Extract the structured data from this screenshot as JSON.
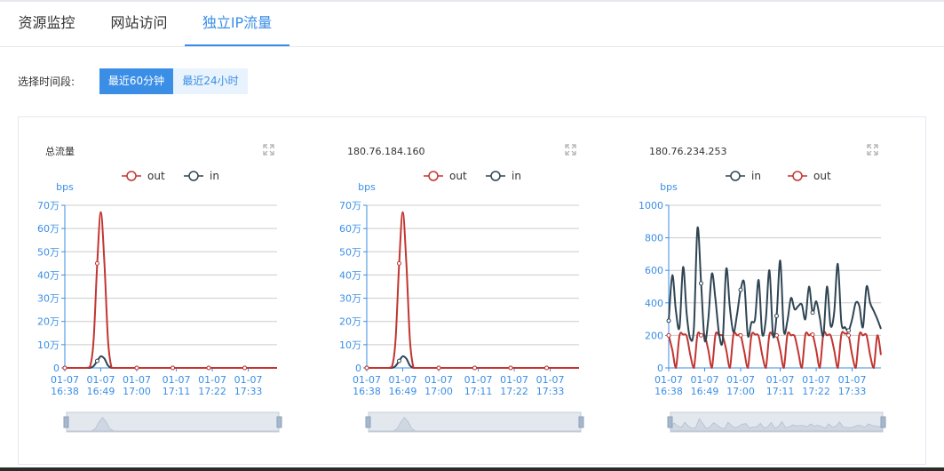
{
  "tabs": [
    {
      "label": "资源监控"
    },
    {
      "label": "网站访问"
    },
    {
      "label": "独立IP流量"
    }
  ],
  "time_range": {
    "label": "选择时间段:",
    "options": [
      "最近60分钟",
      "最近24小时"
    ],
    "selected": "最近60分钟"
  },
  "colors": {
    "out": "#c23531",
    "in": "#2f4554",
    "axis": "#3a8ee6",
    "accent": "#3a8ee6"
  },
  "chart_data": [
    {
      "type": "line",
      "title": "总流量",
      "ylabel": "bps",
      "legend": [
        "out",
        "in"
      ],
      "ylim": [
        0,
        700000
      ],
      "yticks": [
        0,
        100000,
        200000,
        300000,
        400000,
        500000,
        600000,
        700000
      ],
      "ytick_labels": [
        "0",
        "10万",
        "20万",
        "30万",
        "40万",
        "50万",
        "60万",
        "70万"
      ],
      "xtick_labels": [
        [
          "01-07",
          "16:38"
        ],
        [
          "01-07",
          "16:49"
        ],
        [
          "01-07",
          "17:00"
        ],
        [
          "01-07",
          "17:11"
        ],
        [
          "01-07",
          "17:22"
        ],
        [
          "01-07",
          "17:33"
        ]
      ],
      "x_count": 60,
      "series": [
        {
          "name": "out",
          "values": [
            0,
            0,
            0,
            0,
            0,
            0,
            0,
            5000,
            120000,
            450000,
            670000,
            450000,
            120000,
            0,
            0,
            0,
            0,
            0,
            0,
            0,
            0,
            0,
            0,
            0,
            0,
            0,
            0,
            0,
            0,
            0,
            0,
            0,
            0,
            0,
            0,
            0,
            0,
            0,
            0,
            0,
            0,
            0,
            0,
            0,
            0,
            0,
            0,
            0,
            0,
            0,
            0,
            0,
            0,
            0,
            0,
            0,
            0,
            0,
            0,
            0
          ]
        },
        {
          "name": "in",
          "values": [
            0,
            0,
            0,
            0,
            0,
            0,
            0,
            0,
            8000,
            30000,
            50000,
            40000,
            10000,
            0,
            0,
            0,
            0,
            0,
            0,
            0,
            0,
            0,
            0,
            0,
            0,
            0,
            0,
            0,
            0,
            0,
            0,
            0,
            0,
            0,
            0,
            0,
            0,
            0,
            0,
            0,
            0,
            0,
            0,
            0,
            0,
            0,
            0,
            0,
            0,
            0,
            0,
            0,
            0,
            0,
            0,
            0,
            0,
            0,
            0,
            0
          ]
        }
      ]
    },
    {
      "type": "line",
      "title": "180.76.184.160",
      "ylabel": "bps",
      "legend": [
        "out",
        "in"
      ],
      "ylim": [
        0,
        700000
      ],
      "yticks": [
        0,
        100000,
        200000,
        300000,
        400000,
        500000,
        600000,
        700000
      ],
      "ytick_labels": [
        "0",
        "10万",
        "20万",
        "30万",
        "40万",
        "50万",
        "60万",
        "70万"
      ],
      "xtick_labels": [
        [
          "01-07",
          "16:38"
        ],
        [
          "01-07",
          "16:49"
        ],
        [
          "01-07",
          "17:00"
        ],
        [
          "01-07",
          "17:11"
        ],
        [
          "01-07",
          "17:22"
        ],
        [
          "01-07",
          "17:33"
        ]
      ],
      "x_count": 60,
      "series": [
        {
          "name": "out",
          "values": [
            0,
            0,
            0,
            0,
            0,
            0,
            0,
            5000,
            120000,
            450000,
            670000,
            450000,
            120000,
            0,
            0,
            0,
            0,
            0,
            0,
            0,
            0,
            0,
            0,
            0,
            0,
            0,
            0,
            0,
            0,
            0,
            0,
            0,
            0,
            0,
            0,
            0,
            0,
            0,
            0,
            0,
            0,
            0,
            0,
            0,
            0,
            0,
            0,
            0,
            0,
            0,
            0,
            0,
            0,
            0,
            0,
            0,
            0,
            0,
            0,
            0
          ]
        },
        {
          "name": "in",
          "values": [
            0,
            0,
            0,
            0,
            0,
            0,
            0,
            0,
            8000,
            30000,
            50000,
            40000,
            10000,
            0,
            0,
            0,
            0,
            0,
            0,
            0,
            0,
            0,
            0,
            0,
            0,
            0,
            0,
            0,
            0,
            0,
            0,
            0,
            0,
            0,
            0,
            0,
            0,
            0,
            0,
            0,
            0,
            0,
            0,
            0,
            0,
            0,
            0,
            0,
            0,
            0,
            0,
            0,
            0,
            0,
            0,
            0,
            0,
            0,
            0,
            0
          ]
        }
      ]
    },
    {
      "type": "line",
      "title": "180.76.234.253",
      "ylabel": "bps",
      "legend": [
        "in",
        "out"
      ],
      "ylim": [
        0,
        1000
      ],
      "yticks": [
        0,
        200,
        400,
        600,
        800,
        1000
      ],
      "ytick_labels": [
        "0",
        "200",
        "400",
        "600",
        "800",
        "1000"
      ],
      "xtick_labels": [
        [
          "01-07",
          "16:38"
        ],
        [
          "01-07",
          "16:49"
        ],
        [
          "01-07",
          "17:00"
        ],
        [
          "01-07",
          "17:11"
        ],
        [
          "01-07",
          "17:22"
        ],
        [
          "01-07",
          "17:33"
        ]
      ],
      "x_count": 60,
      "series": [
        {
          "name": "in",
          "values": [
            290,
            570,
            350,
            250,
            620,
            330,
            180,
            250,
            860,
            520,
            170,
            300,
            580,
            420,
            210,
            170,
            610,
            370,
            220,
            330,
            480,
            520,
            200,
            280,
            300,
            540,
            210,
            300,
            600,
            200,
            320,
            660,
            230,
            290,
            430,
            360,
            380,
            390,
            300,
            500,
            340,
            410,
            310,
            200,
            500,
            260,
            340,
            640,
            280,
            250,
            230,
            300,
            400,
            380,
            250,
            500,
            400,
            350,
            300,
            240
          ]
        },
        {
          "name": "out",
          "values": [
            200,
            110,
            0,
            200,
            205,
            195,
            80,
            0,
            205,
            200,
            200,
            110,
            0,
            205,
            200,
            195,
            110,
            0,
            205,
            200,
            200,
            100,
            0,
            200,
            205,
            195,
            80,
            0,
            205,
            200,
            200,
            110,
            0,
            205,
            200,
            195,
            100,
            0,
            205,
            200,
            205,
            110,
            0,
            210,
            200,
            200,
            110,
            0,
            205,
            210,
            200,
            80,
            0,
            205,
            200,
            200,
            80,
            0,
            200,
            80
          ]
        }
      ]
    }
  ]
}
